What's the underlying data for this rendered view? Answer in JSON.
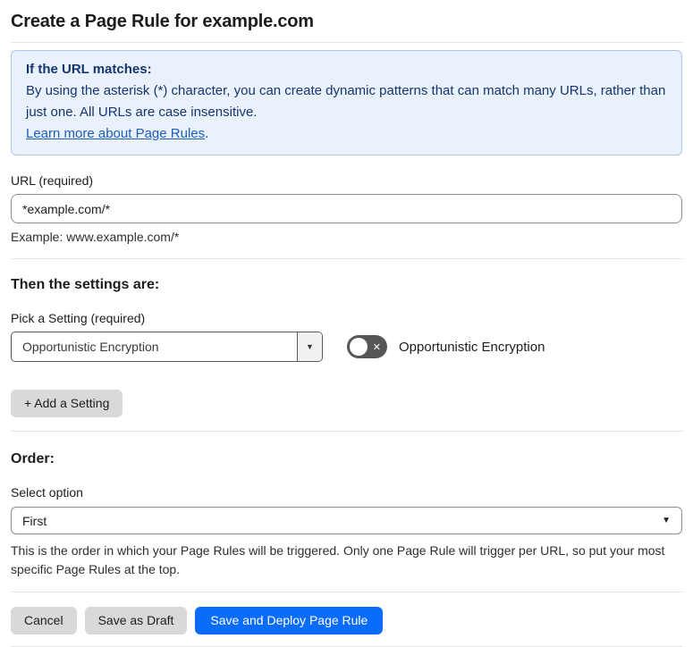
{
  "page": {
    "title": "Create a Page Rule for example.com"
  },
  "info_box": {
    "heading": "If the URL matches:",
    "body": "By using the asterisk (*) character, you can create dynamic patterns that can match many URLs, rather than just one. All URLs are case insensitive.",
    "link_text": "Learn more about Page Rules",
    "link_suffix": "."
  },
  "url_field": {
    "label": "URL (required)",
    "value": "*example.com/*",
    "helper": "Example: www.example.com/*"
  },
  "settings": {
    "heading": "Then the settings are:",
    "pick_label": "Pick a Setting (required)",
    "selected_setting": "Opportunistic Encryption",
    "toggle": {
      "label": "Opportunistic Encryption",
      "state": "off"
    },
    "add_button_label": "+ Add a Setting"
  },
  "order": {
    "heading": "Order:",
    "label": "Select option",
    "selected_option": "First",
    "helper": "This is the order in which your Page Rules will be triggered. Only one Page Rule will trigger per URL, so put your most specific Page Rules at the top."
  },
  "actions": {
    "cancel_label": "Cancel",
    "save_draft_label": "Save as Draft",
    "deploy_label": "Save and Deploy Page Rule"
  },
  "icons": {
    "dropdown_arrow": "▼",
    "toggle_off": "✕"
  },
  "colors": {
    "primary_blue": "#0b6cfb",
    "info_background": "#e9f2fc",
    "info_border": "#a9c9ec",
    "info_text": "#16356e",
    "link_blue": "#1f5cb8",
    "button_gray": "#d9d9d9",
    "toggle_off_gray": "#565656",
    "divider_gray": "#e4e4e4"
  }
}
